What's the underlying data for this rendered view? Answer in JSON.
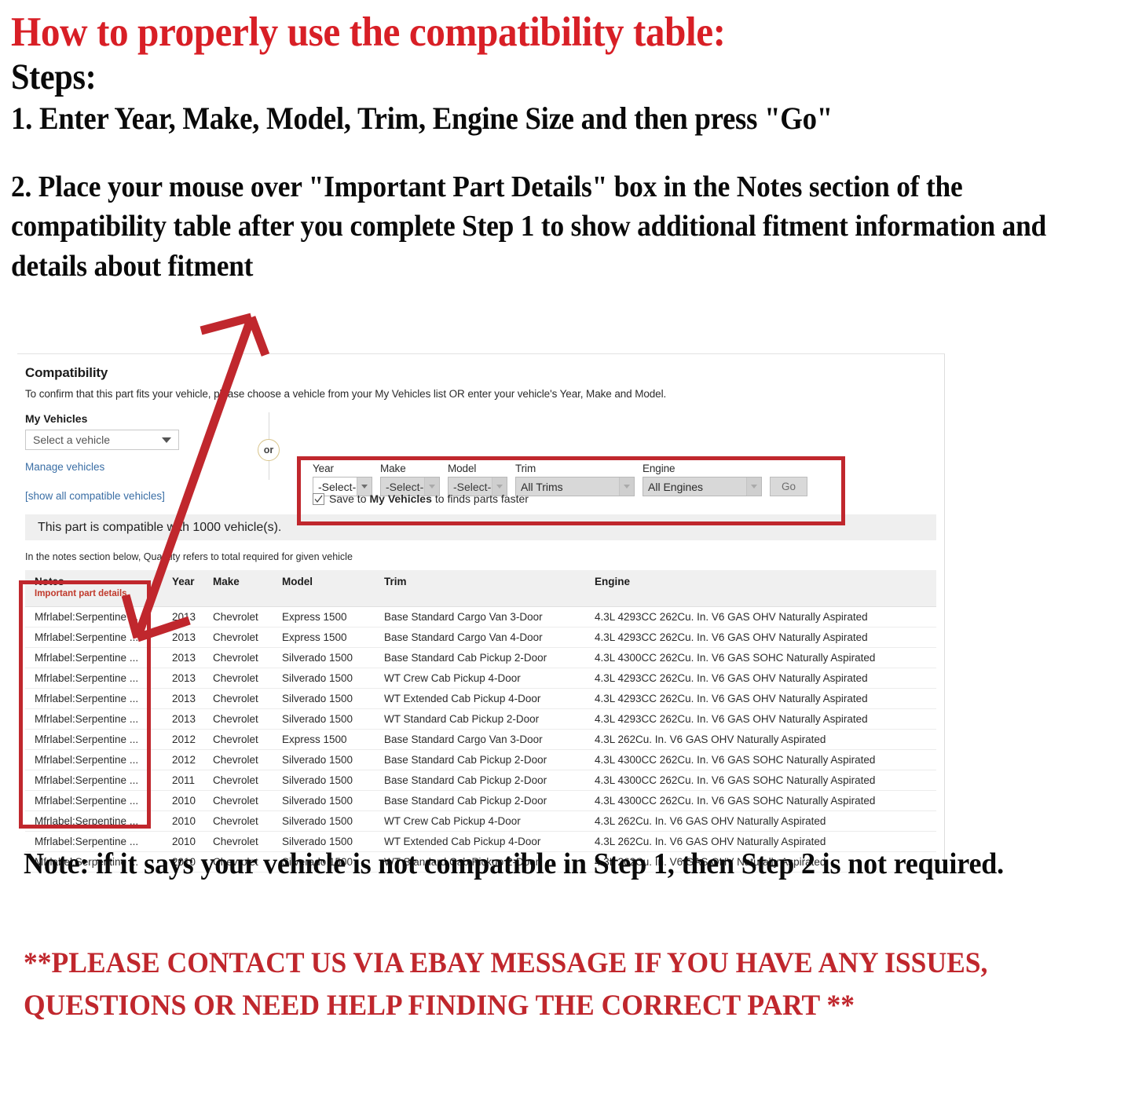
{
  "headline": {
    "title": "How to properly use the compatibility table:",
    "steps_label": "Steps:",
    "step1": "1. Enter Year, Make, Model, Trim, Engine Size and then press \"Go\"",
    "step2": "2. Place your mouse over \"Important Part Details\" box in the Notes section of the compatibility table after you complete Step 1 to show additional fitment information and details about fitment"
  },
  "compatibility": {
    "title": "Compatibility",
    "subtitle": "To confirm that this part fits your vehicle, please choose a vehicle from your My Vehicles list OR enter your vehicle's Year, Make and Model.",
    "my_vehicles_label": "My Vehicles",
    "my_vehicles_value": "Select a vehicle",
    "manage_vehicles_link": "Manage vehicles",
    "or_label": "or",
    "fields": [
      {
        "label": "Year",
        "value": "-Select-",
        "state": "enabled"
      },
      {
        "label": "Make",
        "value": "-Select-",
        "state": "disabled"
      },
      {
        "label": "Model",
        "value": "-Select-",
        "state": "disabled"
      },
      {
        "label": "Trim",
        "value": "All Trims",
        "state": "disabled"
      },
      {
        "label": "Engine",
        "value": "All Engines",
        "state": "disabled"
      }
    ],
    "go_label": "Go",
    "save_checkbox": {
      "checked": true,
      "before": "Save to ",
      "bold": "My Vehicles",
      "after": " to finds parts faster"
    },
    "show_all_link": "[show all compatible vehicles]",
    "compatible_banner": "This part is compatible with 1000 vehicle(s).",
    "notes_hint": "In the notes section below, Quantity refers to total required for given vehicle",
    "accent_red": "#c0272d",
    "link_blue": "#3a6ea5"
  },
  "table": {
    "headers": {
      "notes": "Notes",
      "notes_sub": "Important part details",
      "year": "Year",
      "make": "Make",
      "model": "Model",
      "trim": "Trim",
      "engine": "Engine"
    },
    "rows": [
      {
        "notes": "Mfrlabel:Serpentine ...",
        "year": "2013",
        "make": "Chevrolet",
        "model": "Express 1500",
        "trim": "Base Standard Cargo Van 3-Door",
        "engine": "4.3L 4293CC 262Cu. In. V6 GAS OHV Naturally Aspirated"
      },
      {
        "notes": "Mfrlabel:Serpentine ...",
        "year": "2013",
        "make": "Chevrolet",
        "model": "Express 1500",
        "trim": "Base Standard Cargo Van 4-Door",
        "engine": "4.3L 4293CC 262Cu. In. V6 GAS OHV Naturally Aspirated"
      },
      {
        "notes": "Mfrlabel:Serpentine ...",
        "year": "2013",
        "make": "Chevrolet",
        "model": "Silverado 1500",
        "trim": "Base Standard Cab Pickup 2-Door",
        "engine": "4.3L 4300CC 262Cu. In. V6 GAS SOHC Naturally Aspirated"
      },
      {
        "notes": "Mfrlabel:Serpentine ...",
        "year": "2013",
        "make": "Chevrolet",
        "model": "Silverado 1500",
        "trim": "WT Crew Cab Pickup 4-Door",
        "engine": "4.3L 4293CC 262Cu. In. V6 GAS OHV Naturally Aspirated"
      },
      {
        "notes": "Mfrlabel:Serpentine ...",
        "year": "2013",
        "make": "Chevrolet",
        "model": "Silverado 1500",
        "trim": "WT Extended Cab Pickup 4-Door",
        "engine": "4.3L 4293CC 262Cu. In. V6 GAS OHV Naturally Aspirated"
      },
      {
        "notes": "Mfrlabel:Serpentine ...",
        "year": "2013",
        "make": "Chevrolet",
        "model": "Silverado 1500",
        "trim": "WT Standard Cab Pickup 2-Door",
        "engine": "4.3L 4293CC 262Cu. In. V6 GAS OHV Naturally Aspirated"
      },
      {
        "notes": "Mfrlabel:Serpentine ...",
        "year": "2012",
        "make": "Chevrolet",
        "model": "Express 1500",
        "trim": "Base Standard Cargo Van 3-Door",
        "engine": "4.3L 262Cu. In. V6 GAS OHV Naturally Aspirated"
      },
      {
        "notes": "Mfrlabel:Serpentine ...",
        "year": "2012",
        "make": "Chevrolet",
        "model": "Silverado 1500",
        "trim": "Base Standard Cab Pickup 2-Door",
        "engine": "4.3L 4300CC 262Cu. In. V6 GAS SOHC Naturally Aspirated"
      },
      {
        "notes": "Mfrlabel:Serpentine ...",
        "year": "2011",
        "make": "Chevrolet",
        "model": "Silverado 1500",
        "trim": "Base Standard Cab Pickup 2-Door",
        "engine": "4.3L 4300CC 262Cu. In. V6 GAS SOHC Naturally Aspirated"
      },
      {
        "notes": "Mfrlabel:Serpentine ...",
        "year": "2010",
        "make": "Chevrolet",
        "model": "Silverado 1500",
        "trim": "Base Standard Cab Pickup 2-Door",
        "engine": "4.3L 4300CC 262Cu. In. V6 GAS SOHC Naturally Aspirated"
      },
      {
        "notes": "Mfrlabel:Serpentine ...",
        "year": "2010",
        "make": "Chevrolet",
        "model": "Silverado 1500",
        "trim": "WT Crew Cab Pickup 4-Door",
        "engine": "4.3L 262Cu. In. V6 GAS OHV Naturally Aspirated"
      },
      {
        "notes": "Mfrlabel:Serpentine ...",
        "year": "2010",
        "make": "Chevrolet",
        "model": "Silverado 1500",
        "trim": "WT Extended Cab Pickup 4-Door",
        "engine": "4.3L 262Cu. In. V6 GAS OHV Naturally Aspirated"
      },
      {
        "notes": "Mfrlabel:Serpentine ...",
        "year": "2010",
        "make": "Chevrolet",
        "model": "Silverado 1500",
        "trim": "WT Standard Cab Pickup 2-Door",
        "engine": "4.3L 262Cu. In. V6 GAS OHV Naturally Aspirated"
      }
    ]
  },
  "footer": {
    "note": "Note: if it says your vehicle is not compatible in Step 1, then Step 2 is not required.",
    "contact": "**PLEASE CONTACT US VIA EBAY MESSAGE IF YOU HAVE ANY ISSUES, QUESTIONS OR NEED HELP FINDING THE CORRECT PART **"
  }
}
